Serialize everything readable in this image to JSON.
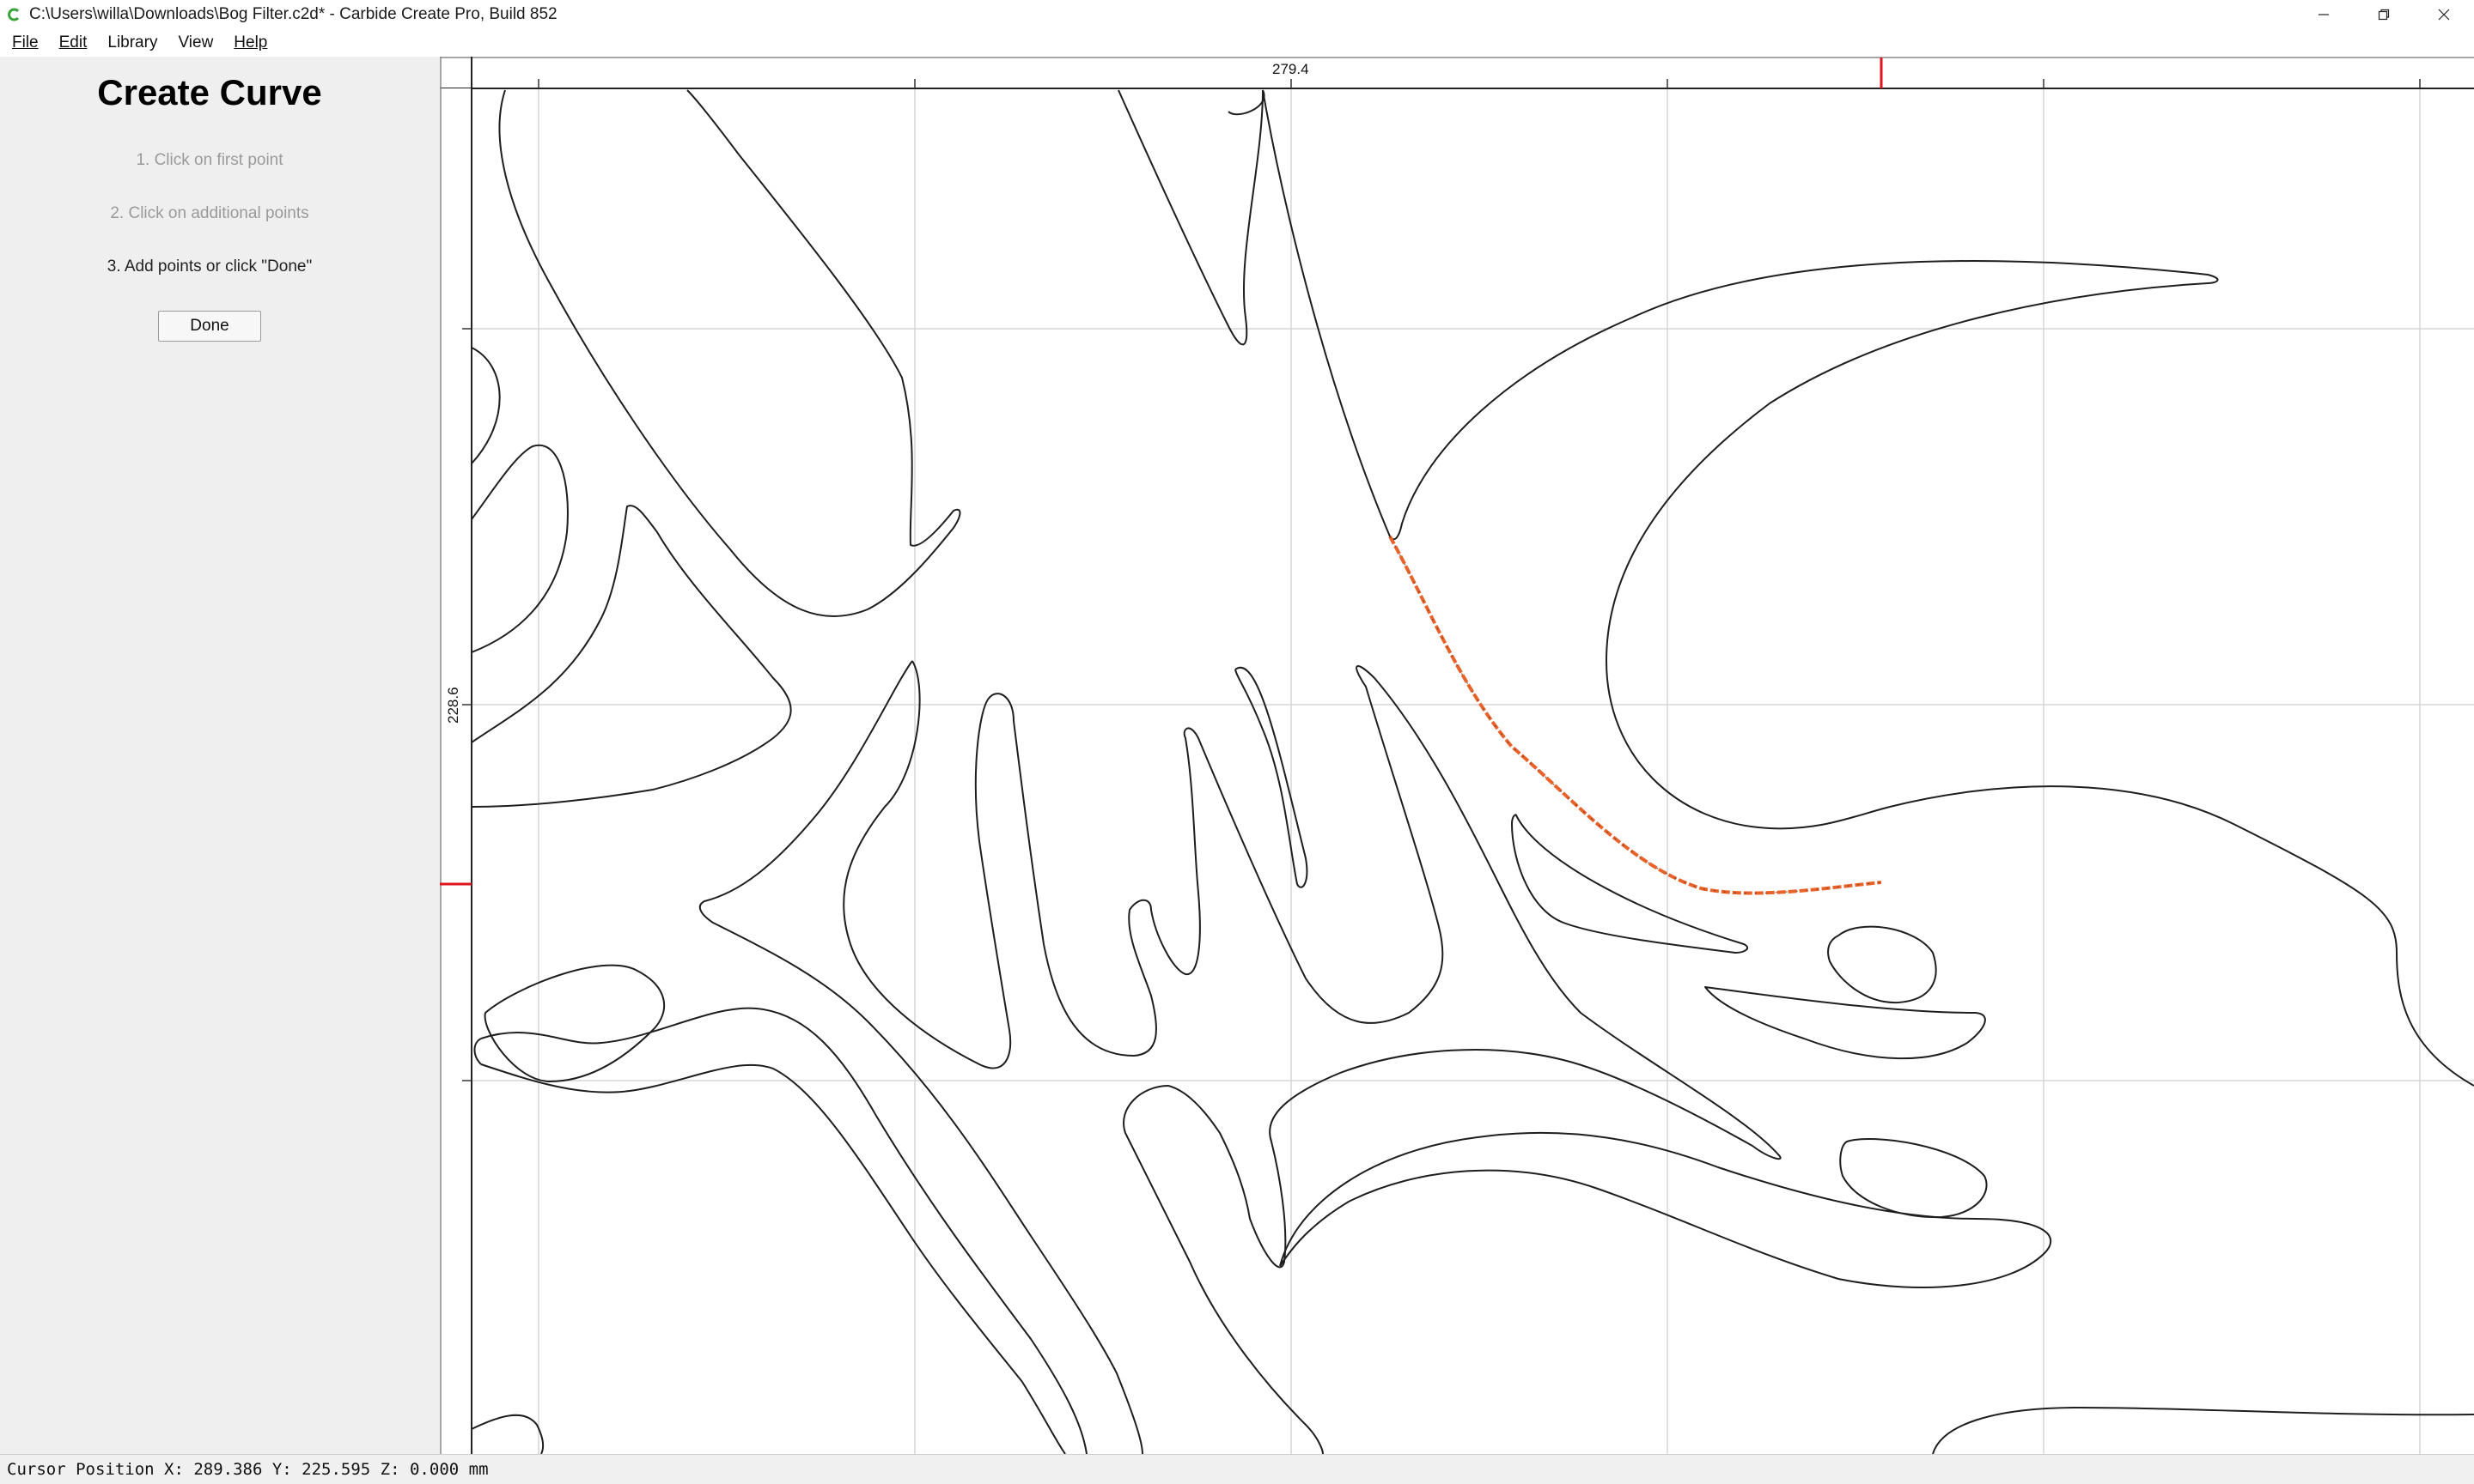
{
  "window": {
    "title": "C:\\Users\\willa\\Downloads\\Bog Filter.c2d* - Carbide Create Pro, Build 852",
    "app_icon": "carbide-create-icon",
    "controls": [
      "minimize-icon",
      "restore-icon",
      "close-icon"
    ]
  },
  "menu": {
    "file": "File",
    "edit": "Edit",
    "library": "Library",
    "view": "View",
    "help": "Help"
  },
  "panel": {
    "title": "Create Curve",
    "step1": "1. Click on first point",
    "step2": "2. Click on additional points",
    "step3": "3. Add points or click \"Done\"",
    "done_label": "Done"
  },
  "canvas": {
    "ruler_x_label": "279.4",
    "ruler_y_label": "228.6",
    "active_curve_color": "#e8622a",
    "cursor_marker_color": "#e0141e",
    "grid_color": "#d6d6d6",
    "line_color": "#1e1e1e"
  },
  "status": {
    "cursor_position": "Cursor Position X: 289.386 Y: 225.595 Z: 0.000 mm"
  }
}
